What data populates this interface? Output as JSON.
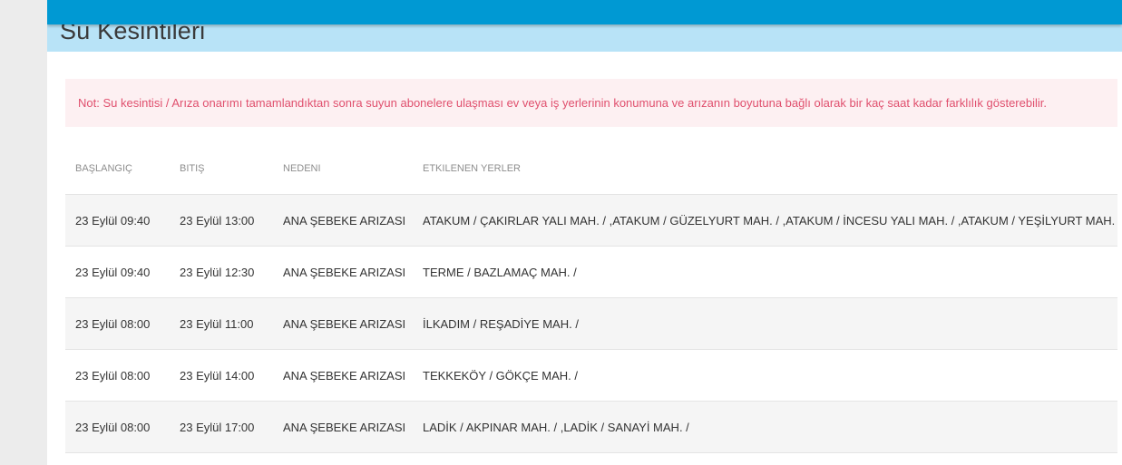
{
  "page": {
    "title": "Su Kesintileri",
    "notice": "Not: Su kesintisi / Arıza onarımı tamamlandıktan sonra suyun abonelere ulaşması ev veya iş yerlerinin konumuna ve arızanın boyutuna bağlı olarak bir kaç saat kadar farklılık gösterebilir."
  },
  "colors": {
    "top_bar": "#0099d3",
    "title_band": "#b8e3f7",
    "notice_background": "#fdf0f2",
    "notice_text": "#e0506e"
  },
  "table": {
    "headers": [
      "BAŞLANGIÇ",
      "BITIŞ",
      "NEDENI",
      "ETKILENEN YERLER"
    ],
    "rows": [
      [
        "23 Eylül 09:40",
        "23 Eylül 13:00",
        "ANA ŞEBEKE ARIZASI",
        "ATAKUM / ÇAKIRLAR YALI MAH. / ,ATAKUM / GÜZELYURT MAH. / ,ATAKUM / İNCESU YALI MAH. / ,ATAKUM / YEŞİLYURT MAH. /"
      ],
      [
        "23 Eylül 09:40",
        "23 Eylül 12:30",
        "ANA ŞEBEKE ARIZASI",
        "TERME / BAZLAMAÇ MAH. /"
      ],
      [
        "23 Eylül 08:00",
        "23 Eylül 11:00",
        "ANA ŞEBEKE ARIZASI",
        "İLKADIM / REŞADİYE MAH. /"
      ],
      [
        "23 Eylül 08:00",
        "23 Eylül 14:00",
        "ANA ŞEBEKE ARIZASI",
        "TEKKEKÖY / GÖKÇE MAH. /"
      ],
      [
        "23 Eylül 08:00",
        "23 Eylül 17:00",
        "ANA ŞEBEKE ARIZASI",
        "LADİK / AKPINAR MAH. / ,LADİK / SANAYİ MAH. /"
      ]
    ]
  }
}
